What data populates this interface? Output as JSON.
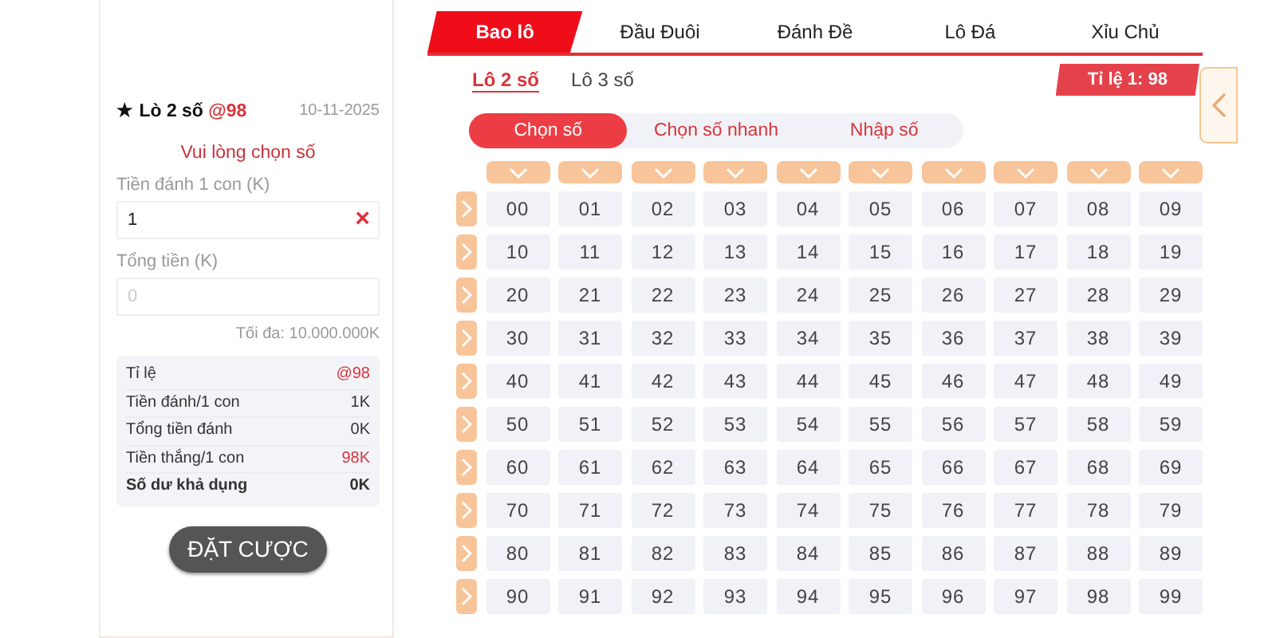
{
  "bet_panel": {
    "title": {
      "star": "★",
      "label": "Lò 2 số",
      "rate": "@98"
    },
    "date": "10-11-2025",
    "hint": "Vui lòng chọn số",
    "fields": [
      {
        "label": "Tiền đánh 1 con (K)",
        "value": "1",
        "clear": "×"
      },
      {
        "label": "Tổng tiền (K)",
        "placeholder": "0"
      }
    ],
    "limit": "Tối đa: 10.000.000K",
    "summary": [
      {
        "label": "Tỉ lệ",
        "value": "@98",
        "kind": "highlight"
      },
      {
        "label": "Tiền đánh/1 con",
        "value": "1K",
        "kind": "normal"
      },
      {
        "label": "Tổng tiền đánh",
        "value": "0K",
        "kind": "normal"
      },
      {
        "label": "Tiền thắng/1 con",
        "value": "98K",
        "kind": "highlight"
      },
      {
        "label": "Số dư khả dụng",
        "value": "0K",
        "kind": "total"
      }
    ],
    "submit": "ĐẶT CƯỢC"
  },
  "tabs": [
    {
      "label": "Bao lô",
      "selected": true
    },
    {
      "label": "Đầu Đuôi",
      "selected": false
    },
    {
      "label": "Đánh Đề",
      "selected": false
    },
    {
      "label": "Lô Đá",
      "selected": false
    },
    {
      "label": "Xỉu Chủ",
      "selected": false
    }
  ],
  "sub_tabs": [
    {
      "label": "Lô 2 số",
      "selected": true
    },
    {
      "label": "Lô 3 số",
      "selected": false
    }
  ],
  "ratio": "Tỉ lệ 1: 98",
  "modes": [
    {
      "label": "Chọn số",
      "selected": true
    },
    {
      "label": "Chọn số nhanh",
      "selected": false
    },
    {
      "label": "Nhập số",
      "selected": false
    }
  ],
  "grid": [
    [
      "00",
      "01",
      "02",
      "03",
      "04",
      "05",
      "06",
      "07",
      "08",
      "09"
    ],
    [
      "10",
      "11",
      "12",
      "13",
      "14",
      "15",
      "16",
      "17",
      "18",
      "19"
    ],
    [
      "20",
      "21",
      "22",
      "23",
      "24",
      "25",
      "26",
      "27",
      "28",
      "29"
    ],
    [
      "30",
      "31",
      "32",
      "33",
      "34",
      "35",
      "36",
      "37",
      "38",
      "39"
    ],
    [
      "40",
      "41",
      "42",
      "43",
      "44",
      "45",
      "46",
      "47",
      "48",
      "49"
    ],
    [
      "50",
      "51",
      "52",
      "53",
      "54",
      "55",
      "56",
      "57",
      "58",
      "59"
    ],
    [
      "60",
      "61",
      "62",
      "63",
      "64",
      "65",
      "66",
      "67",
      "68",
      "69"
    ],
    [
      "70",
      "71",
      "72",
      "73",
      "74",
      "75",
      "76",
      "77",
      "78",
      "79"
    ],
    [
      "80",
      "81",
      "82",
      "83",
      "84",
      "85",
      "86",
      "87",
      "88",
      "89"
    ],
    [
      "90",
      "91",
      "92",
      "93",
      "94",
      "95",
      "96",
      "97",
      "98",
      "99"
    ]
  ]
}
